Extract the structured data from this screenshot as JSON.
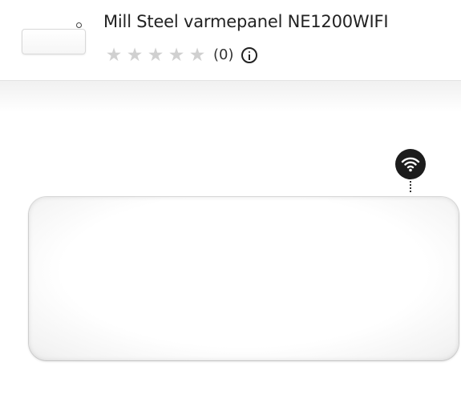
{
  "product": {
    "title": "Mill Steel varmepanel NE1200WIFI",
    "review_count": "(0)",
    "rating_stars": 0,
    "rating_max": 5
  },
  "icons": {
    "rating": "star-icon",
    "info": "info-icon",
    "wifi": "wifi-icon"
  },
  "colors": {
    "star_empty": "#d0d0d0",
    "wifi_badge": "#1c1c1c",
    "title_text": "#222222"
  }
}
